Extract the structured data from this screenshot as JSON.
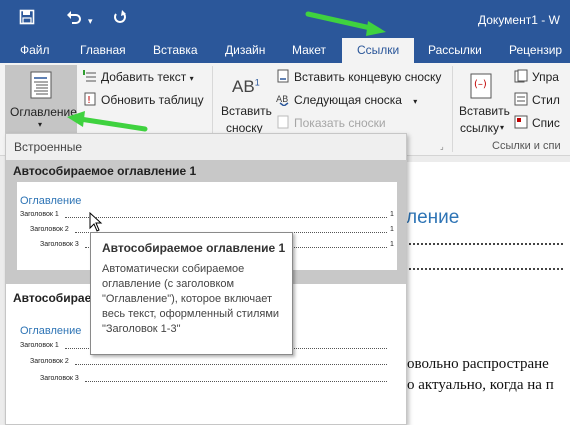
{
  "quick_access": {
    "save_icon": "save-icon",
    "undo_icon": "undo-icon",
    "redo_icon": "redo-icon",
    "dropdown_icon": "chevron-down-icon"
  },
  "window": {
    "title": "Документ1 - W"
  },
  "tabs": [
    "Файл",
    "Главная",
    "Вставка",
    "Дизайн",
    "Макет",
    "Ссылки",
    "Рассылки",
    "Рецензир"
  ],
  "active_tab": "Ссылки",
  "ribbon": {
    "toc_button": "Оглавление",
    "add_text": "Добавить текст",
    "update_table": "Обновить таблицу",
    "insert_footnote_line1": "Вставить",
    "insert_footnote_line2": "сноску",
    "insert_endnote": "Вставить концевую сноску",
    "next_footnote": "Следующая сноска",
    "show_notes": "Показать сноски",
    "insert_citation_line1": "Вставить",
    "insert_citation_line2": "ссылку",
    "manage": "Упра",
    "style": "Стил",
    "bibliography": "Спис",
    "group_citations": "Ссылки и спи",
    "footnote_icon_text": "AB",
    "footnote_icon_sup": "1"
  },
  "dropdown": {
    "section": "Встроенные",
    "item1_title": "Автособираемое оглавление 1",
    "item2_title": "Автособирае",
    "preview_title": "Оглавление",
    "entries": [
      {
        "label": "Заголовок 1",
        "page": "1"
      },
      {
        "label": "Заголовок 2",
        "page": "1"
      },
      {
        "label": "Заголовок 3",
        "page": "1"
      }
    ]
  },
  "tooltip": {
    "title": "Автособираемое оглавление 1",
    "body": "Автоматически собираемое оглавление (с заголовком \"Оглавление\"), которое включает весь текст, оформленный стилями \"Заголовок 1-3\""
  },
  "document": {
    "heading": "ление",
    "line1": "овольно распростране",
    "line2": "о актуально, когда на п"
  },
  "colors": {
    "brand": "#2b579a",
    "heading": "#2e74b5",
    "arrow": "#3fd23f"
  }
}
